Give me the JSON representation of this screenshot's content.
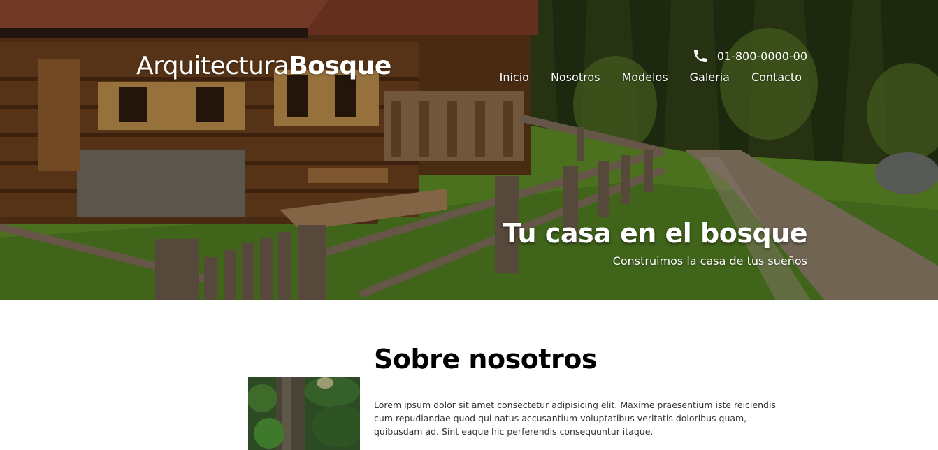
{
  "header": {
    "logo_light": "Arquitectura",
    "logo_bold": "Bosque",
    "phone": "01-800-0000-00",
    "nav": [
      "Inicio",
      "Nosotros",
      "Modelos",
      "Galeria",
      "Contacto"
    ]
  },
  "hero": {
    "title": "Tu casa en el bosque",
    "subtitle": "Construimos la casa de tus sueños"
  },
  "about": {
    "title": "Sobre nosotros",
    "text": "Lorem ipsum dolor sit amet consectetur adipisicing elit. Maxime praesentium iste reiciendis cum repudiandae quod qui natus accusantium voluptatibus veritatis doloribus quam, quibusdam ad. Sint eaque hic perferendis consequuntur itaque."
  },
  "icons": {
    "phone": "phone-icon"
  },
  "colors": {
    "text_on_hero": "#ffffff",
    "heading": "#000000",
    "body_text": "#333333"
  }
}
